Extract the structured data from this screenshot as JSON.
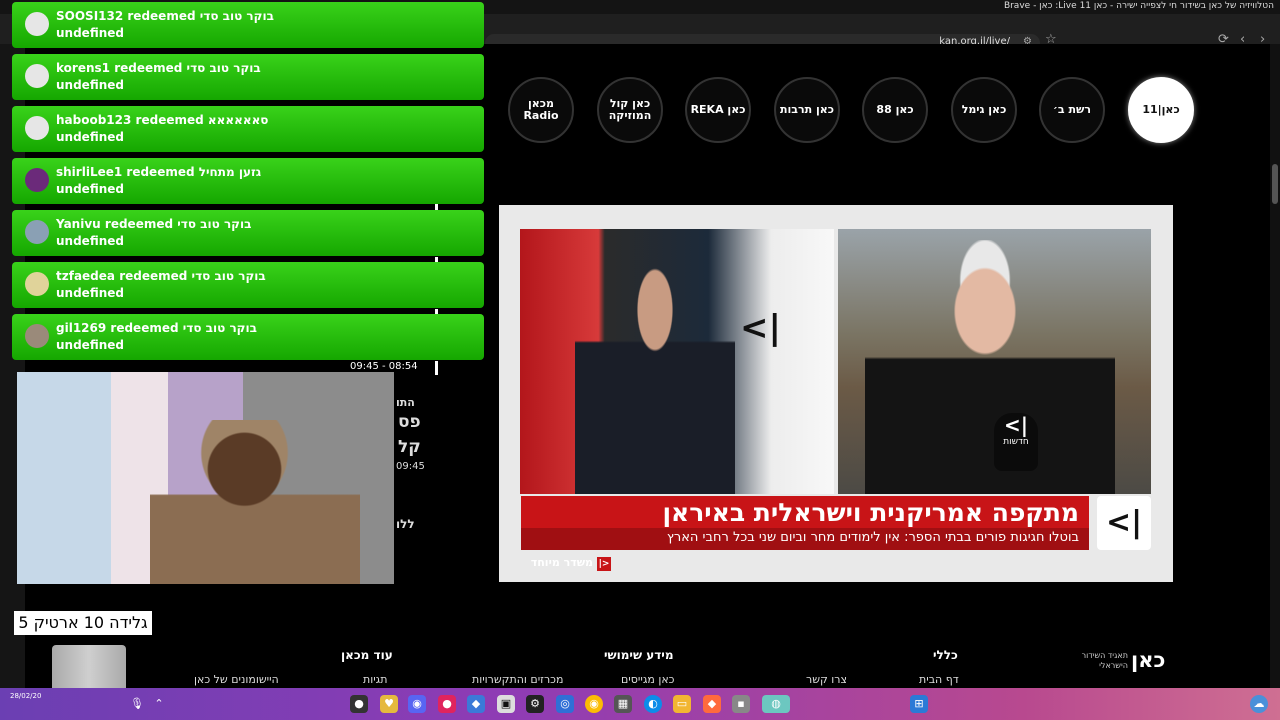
{
  "window": {
    "title": "הטלוויזיה של כאן בשידור חי לצפייה ישירה - כאן 11 Live: כאן - Brave"
  },
  "browser": {
    "url": "kan.org.il/live/"
  },
  "channels": [
    {
      "label": "כאן|11",
      "icon": "kan11-logo"
    },
    {
      "label": "רשת ב׳",
      "icon": "reshet-bet-logo"
    },
    {
      "label": "כאן גימל",
      "icon": "gimel-logo"
    },
    {
      "label": "כאן 88",
      "icon": "kan88-logo"
    },
    {
      "label": "כאן תרבות",
      "icon": "tarbut-logo"
    },
    {
      "label": "כאן REKA",
      "icon": "reka-logo"
    },
    {
      "label": "כאן קול המוזיקה",
      "icon": "kol-hamusica-logo"
    },
    {
      "label": "מכאן Radio",
      "icon": "makan-logo"
    }
  ],
  "video": {
    "headline": "מתקפה אמריקנית וישראלית באיראן",
    "subline": "בוטלו חגיגות פורים בבתי הספר: אין לימודים מחר וביום שני בכל רחבי הארץ",
    "special": "משדר מיוחד",
    "mic_label": "חדשות",
    "logo_glyph": "⎸<"
  },
  "alerts": [
    {
      "user": "SOOSI132",
      "reward": "בוקר טוב סדי",
      "sub": "undefined"
    },
    {
      "user": "korens1",
      "reward": "בוקר טוב סדי",
      "sub": "undefined"
    },
    {
      "user": "haboob123",
      "reward": "סאאאאאא",
      "sub": "undefined"
    },
    {
      "user": "shirliLee1",
      "reward": "גזען מתחיל",
      "sub": "undefined"
    },
    {
      "user": "Yanivu",
      "reward": "בוקר טוב סדי",
      "sub": "undefined"
    },
    {
      "user": "tzfaedea",
      "reward": "בוקר טוב סדי",
      "sub": "undefined"
    },
    {
      "user": "gil1269",
      "reward": "בוקר טוב סדי",
      "sub": "undefined"
    }
  ],
  "alert_verb": "redeemed",
  "schedule": {
    "time": "09:45 - 08:54",
    "time2": "09:45"
  },
  "ghost_text": {
    "a": "התו",
    "b": "פס",
    "c": "קל",
    "d": "ללו"
  },
  "caption": "גלידה 10 ארטיק 5",
  "footer": {
    "org": "תאגיד השידור הישראלי",
    "logo": "כאן",
    "cols": [
      {
        "title": "כללי",
        "links": [
          "דף הבית",
          "צרו קשר"
        ]
      },
      {
        "title": "מידע שימושי",
        "links": [
          "כאן מגייסים",
          "מכרזים והתקשרויות"
        ]
      },
      {
        "title": "עוד מכאן",
        "links": [
          "תגיות",
          "היישומונים של כאן"
        ]
      }
    ]
  },
  "taskbar": {
    "date": "28/02/20"
  }
}
